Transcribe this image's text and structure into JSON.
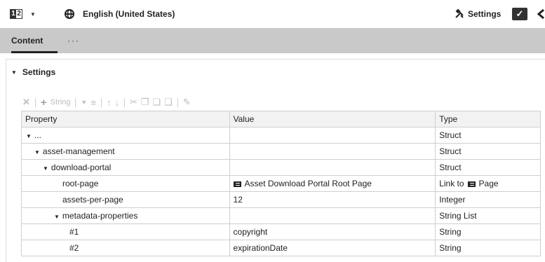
{
  "topbar": {
    "version_left": "1",
    "version_right": "2",
    "language": "English (United States)",
    "settings_label": "Settings",
    "icons": [
      "version-icon",
      "chevron-down-icon",
      "globe-icon",
      "tools-icon",
      "check-icon",
      "chevron-left-icon"
    ]
  },
  "tabs": {
    "active": "Content",
    "more": "···"
  },
  "section": {
    "title": "Settings"
  },
  "toolbar": {
    "add_type": "String",
    "icons": [
      "delete-icon",
      "add-icon",
      "dropdown-icon",
      "sort-icon",
      "move-up-icon",
      "move-down-icon",
      "cut-icon",
      "copy-icon",
      "paste-icon",
      "paste-special-icon",
      "edit-icon"
    ]
  },
  "table": {
    "headers": {
      "property": "Property",
      "value": "Value",
      "type": "Type"
    },
    "rows": [
      {
        "indent": 0,
        "expand": true,
        "property": "...",
        "value": "",
        "type": "Struct",
        "value_icon": false,
        "type_icon": false
      },
      {
        "indent": 1,
        "expand": true,
        "property": "asset-management",
        "value": "",
        "type": "Struct",
        "value_icon": false,
        "type_icon": false
      },
      {
        "indent": 2,
        "expand": true,
        "property": "download-portal",
        "value": "",
        "type": "Struct",
        "value_icon": false,
        "type_icon": false
      },
      {
        "indent": 3,
        "expand": false,
        "property": "root-page",
        "value": "Asset Download Portal Root Page",
        "type_prefix": "Link to",
        "type": "Page",
        "value_icon": true,
        "type_icon": true
      },
      {
        "indent": 3,
        "expand": false,
        "property": "assets-per-page",
        "value": "12",
        "type": "Integer",
        "value_icon": false,
        "type_icon": false
      },
      {
        "indent": 3,
        "expand": true,
        "property": "metadata-properties",
        "value": "",
        "type": "String List",
        "value_icon": false,
        "type_icon": false
      },
      {
        "indent": 4,
        "expand": false,
        "property": "#1",
        "value": "copyright",
        "type": "String",
        "value_icon": false,
        "type_icon": false
      },
      {
        "indent": 4,
        "expand": false,
        "property": "#2",
        "value": "expirationDate",
        "type": "String",
        "value_icon": false,
        "type_icon": false
      }
    ]
  }
}
